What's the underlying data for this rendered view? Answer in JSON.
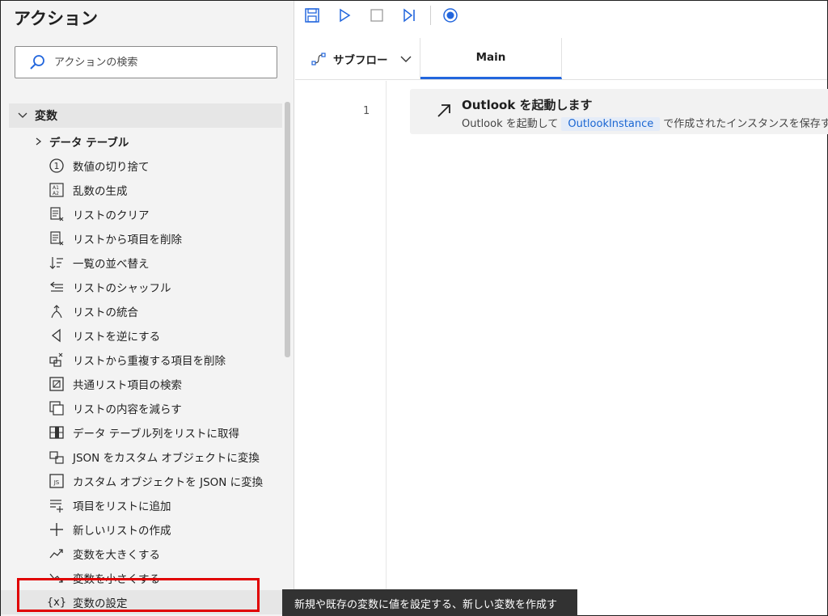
{
  "actions_pane": {
    "title": "アクション",
    "search_placeholder": "アクションの検索",
    "category": "変数",
    "subgroup": "データ テーブル",
    "items": [
      {
        "label": "数値の切り捨て",
        "icon": "circled-one-icon"
      },
      {
        "label": "乱数の生成",
        "icon": "random-az-icon"
      },
      {
        "label": "リストのクリア",
        "icon": "list-clear-icon"
      },
      {
        "label": "リストから項目を削除",
        "icon": "list-remove-item-icon"
      },
      {
        "label": "一覧の並べ替え",
        "icon": "sort-list-icon"
      },
      {
        "label": "リストのシャッフル",
        "icon": "shuffle-list-icon"
      },
      {
        "label": "リストの統合",
        "icon": "merge-list-icon"
      },
      {
        "label": "リストを逆にする",
        "icon": "reverse-list-icon"
      },
      {
        "label": "リストから重複する項目を削除",
        "icon": "remove-duplicates-icon"
      },
      {
        "label": "共通リスト項目の検索",
        "icon": "common-items-icon"
      },
      {
        "label": "リストの内容を減らす",
        "icon": "subtract-list-icon"
      },
      {
        "label": "データ テーブル列をリストに取得",
        "icon": "table-column-icon"
      },
      {
        "label": "JSON をカスタム オブジェクトに変換",
        "icon": "json-convert-icon"
      },
      {
        "label": "カスタム オブジェクトを JSON に変換",
        "icon": "js-file-icon"
      },
      {
        "label": "項目をリストに追加",
        "icon": "add-to-list-icon"
      },
      {
        "label": "新しいリストの作成",
        "icon": "plus-icon"
      },
      {
        "label": "変数を大きくする",
        "icon": "trend-up-icon"
      },
      {
        "label": "変数を小さくする",
        "icon": "trend-down-icon"
      },
      {
        "label": "変数の設定",
        "icon": "variable-braces-icon",
        "glyph": "{x}"
      }
    ]
  },
  "designer": {
    "subflow_label": "サブフロー",
    "main_tab_label": "Main",
    "step": {
      "number": "1",
      "title": "Outlook を起動します",
      "desc_before": "Outlook を起動して",
      "variable": "OutlookInstance",
      "desc_after": "で作成されたインスタンスを保存す"
    }
  },
  "tooltip": "新規や既存の変数に値を設定する、新しい変数を作成す",
  "colors": {
    "accent": "#2266dd",
    "highlight_box": "#e00000",
    "tooltip_bg": "#323232"
  }
}
